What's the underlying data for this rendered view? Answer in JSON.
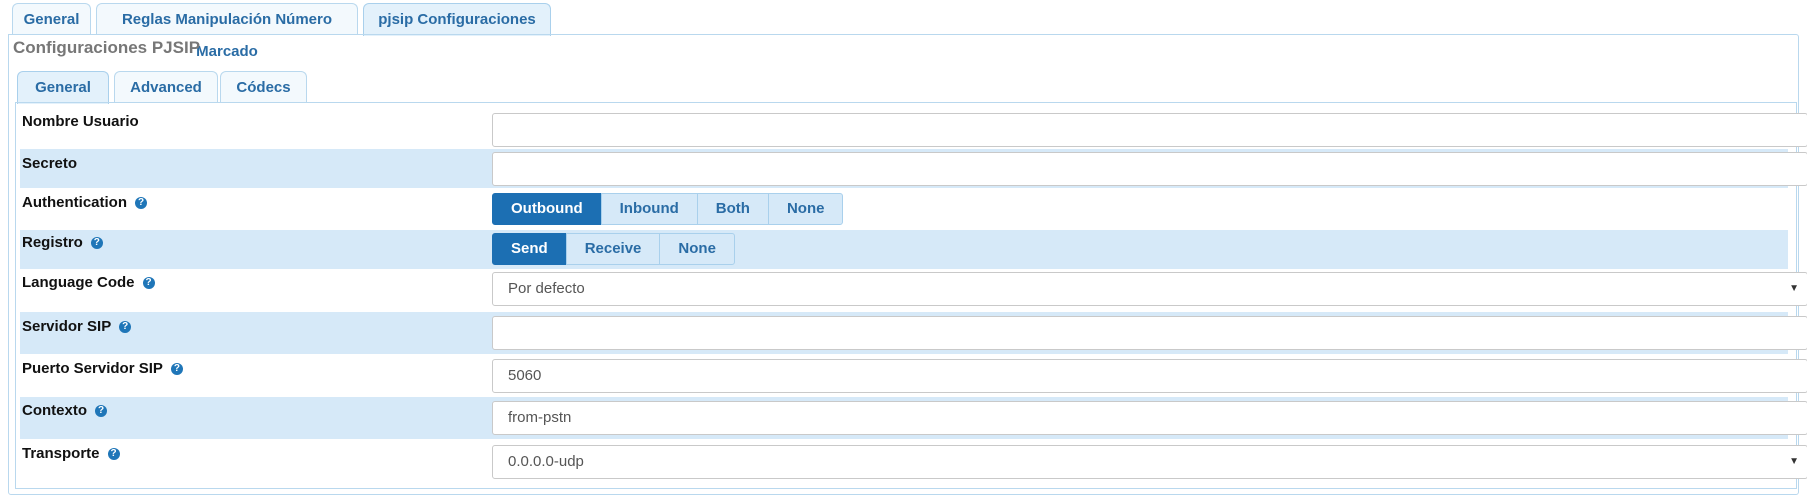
{
  "top_tabs": [
    "General",
    "Reglas Manipulación Número Marcado",
    "pjsip Configuraciones"
  ],
  "section_title": "Configuraciones PJSIP",
  "inner_tabs": [
    "General",
    "Advanced",
    "Códecs"
  ],
  "form": {
    "nombre_usuario": {
      "label": "Nombre Usuario",
      "value": ""
    },
    "secreto": {
      "label": "Secreto",
      "value": ""
    },
    "authentication": {
      "label": "Authentication",
      "options": [
        "Outbound",
        "Inbound",
        "Both",
        "None"
      ],
      "selected": "Outbound"
    },
    "registro": {
      "label": "Registro",
      "options": [
        "Send",
        "Receive",
        "None"
      ],
      "selected": "Send"
    },
    "language_code": {
      "label": "Language Code",
      "value": "Por defecto"
    },
    "servidor_sip": {
      "label": "Servidor SIP",
      "value": ""
    },
    "puerto_servidor_sip": {
      "label": "Puerto Servidor SIP",
      "value": "5060"
    },
    "contexto": {
      "label": "Contexto",
      "value": "from-pstn"
    },
    "transporte": {
      "label": "Transporte",
      "value": "0.0.0.0-udp"
    }
  },
  "help_glyph": "?",
  "dropdown_glyph": "▼"
}
